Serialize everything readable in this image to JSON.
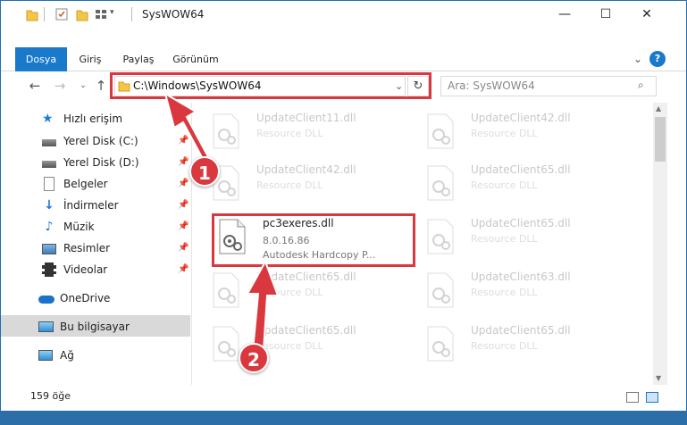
{
  "window": {
    "title": "SysWOW64"
  },
  "ribbon": {
    "tabs": [
      "Dosya",
      "Giriş",
      "Paylaş",
      "Görünüm"
    ]
  },
  "nav": {
    "address": "C:\\Windows\\SysWOW64",
    "search_placeholder": "Ara: SysWOW64"
  },
  "sidebar": {
    "items": [
      {
        "label": "Hızlı erişim",
        "icon": "star-icon"
      },
      {
        "label": "Yerel Disk (C:)",
        "icon": "drive-icon"
      },
      {
        "label": "Yerel Disk (D:)",
        "icon": "drive-icon"
      },
      {
        "label": "Belgeler",
        "icon": "document-icon"
      },
      {
        "label": "İndirmeler",
        "icon": "download-icon"
      },
      {
        "label": "Müzik",
        "icon": "music-icon"
      },
      {
        "label": "Resimler",
        "icon": "pictures-icon"
      },
      {
        "label": "Videolar",
        "icon": "video-icon"
      },
      {
        "label": "OneDrive",
        "icon": "cloud-icon"
      },
      {
        "label": "Bu bilgisayar",
        "icon": "computer-icon"
      },
      {
        "label": "Ağ",
        "icon": "network-icon"
      }
    ]
  },
  "files": {
    "focused": {
      "name": "pc3exeres.dll",
      "version": "8.0.16.86",
      "description": "Autodesk Hardcopy P..."
    },
    "faded": [
      {
        "name": "UpdateClient11.dll",
        "type": "Resource DLL"
      },
      {
        "name": "UpdateClient42.dll",
        "type": "Resource DLL"
      },
      {
        "name": "UpdateClient42.dll",
        "type": "Resource DLL"
      },
      {
        "name": "UpdateClient65.dll",
        "type": "Resource DLL"
      },
      {
        "name": "UpdateClient65.dll",
        "type": "Resource DLL"
      },
      {
        "name": "UpdateClient65.dll",
        "type": "Resource DLL"
      },
      {
        "name": "UpdateClient63.dll",
        "type": "Resource DLL"
      },
      {
        "name": "UpdateClient65.dll",
        "type": "Resource DLL"
      },
      {
        "name": "UpdateClient65.dll",
        "type": "Resource DLL"
      },
      {
        "name": "UpdateClient65.dll",
        "type": "Resource DLL"
      }
    ]
  },
  "status": {
    "count": "159 öğe"
  },
  "annotations": {
    "step1": "1",
    "step2": "2"
  },
  "colors": {
    "accent": "#1979ca",
    "highlight": "#d9383f"
  }
}
